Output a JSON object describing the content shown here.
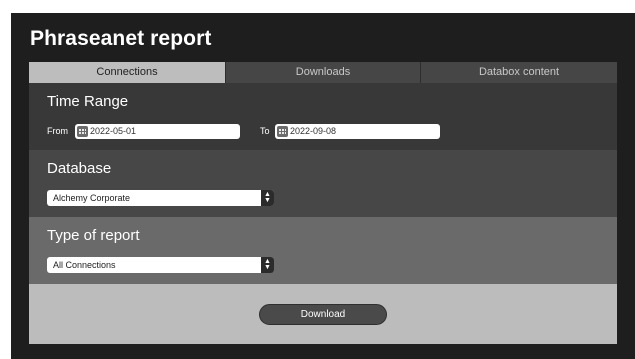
{
  "app": {
    "title": "Phraseanet report"
  },
  "tabs": [
    {
      "label": "Connections",
      "active": true
    },
    {
      "label": "Downloads",
      "active": false
    },
    {
      "label": "Databox content",
      "active": false
    }
  ],
  "time_range": {
    "heading": "Time Range",
    "from_label": "From",
    "from_value": "2022-05-01",
    "to_label": "To",
    "to_value": "2022-09-08",
    "icon": "calendar-icon"
  },
  "database": {
    "heading": "Database",
    "selected": "Alchemy Corporate"
  },
  "report_type": {
    "heading": "Type of report",
    "selected": "All Connections"
  },
  "actions": {
    "download_label": "Download"
  },
  "colors": {
    "window_bg": "#1e1e1e",
    "active_tab": "#bdbdbd",
    "inactive_tab": "#464646",
    "section_time": "#383838",
    "section_db": "#474747",
    "section_type": "#6a6a6a",
    "section_action": "#bcbcbc"
  }
}
